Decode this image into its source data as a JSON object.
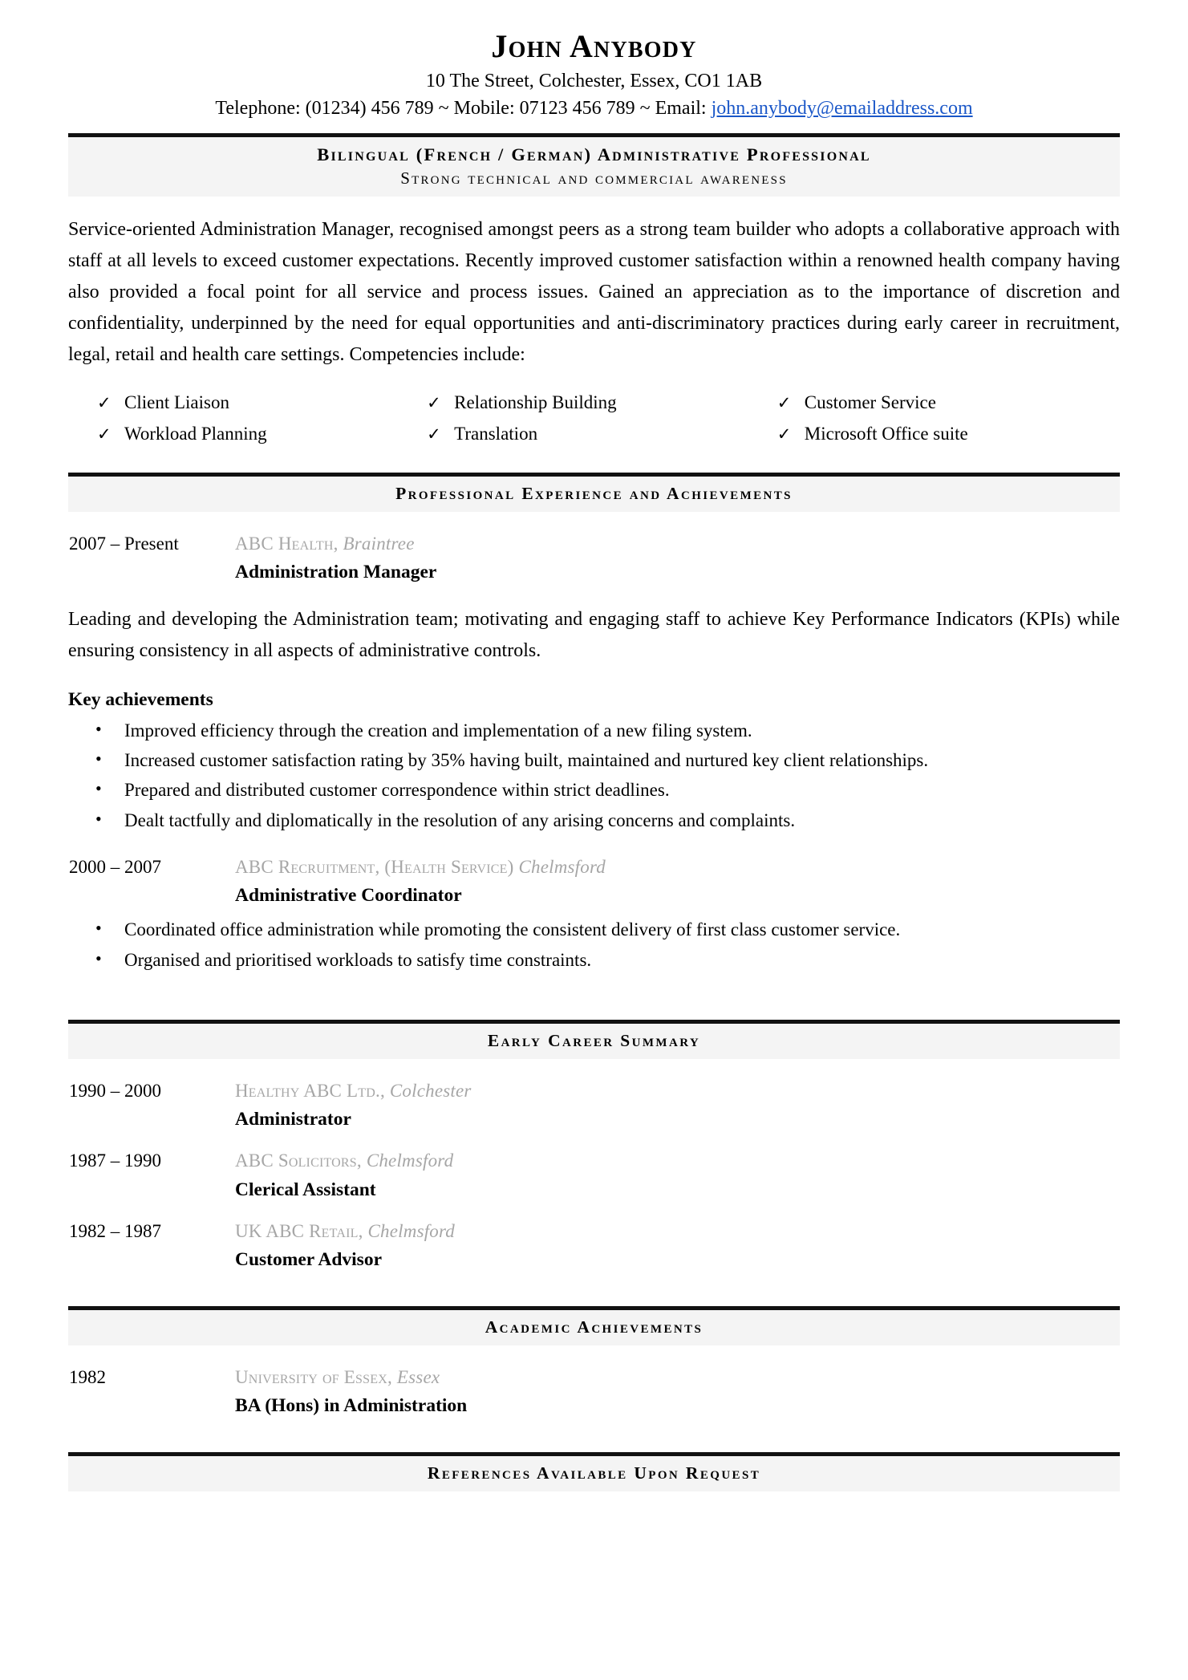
{
  "header": {
    "name": "John Anybody",
    "address": "10 The Street, Colchester, Essex, CO1 1AB",
    "contact_prefix": "Telephone: (01234) 456 789 ~ Mobile: 07123 456 789 ~ Email: ",
    "email": "john.anybody@emailaddress.com"
  },
  "title_banner": {
    "main": "Bilingual (French / German) Administrative Professional",
    "sub": "Strong technical and commercial awareness"
  },
  "profile": {
    "text": "Service-oriented Administration Manager, recognised amongst peers as a strong team builder who adopts a collaborative approach with staff at all levels to exceed customer expectations. Recently improved customer satisfaction within a renowned health company having also provided a focal point for all service and process issues. Gained an appreciation as to the importance of discretion and confidentiality, underpinned by the need for equal opportunities and anti-discriminatory practices during early career in recruitment, legal, retail and health care settings. Competencies include:"
  },
  "competencies": {
    "check_glyph": "✓",
    "rows": [
      [
        "Client Liaison",
        "Relationship Building",
        "Customer Service"
      ],
      [
        "Workload Planning",
        "Translation",
        "Microsoft Office suite"
      ]
    ]
  },
  "experience": {
    "banner": "Professional Experience and Achievements",
    "jobs": [
      {
        "dates": "2007 – Present",
        "company": "ABC Health,",
        "location": "Braintree",
        "title": "Administration Manager",
        "summary": "Leading and developing the Administration team; motivating and engaging staff to achieve Key Performance Indicators (KPIs) while ensuring consistency in all aspects of administrative controls.",
        "achievements_heading": "Key achievements",
        "bullets": [
          "Improved efficiency through the creation and implementation of a new filing system.",
          "Increased customer satisfaction rating by 35% having built, maintained and nurtured key client relationships.",
          "Prepared and distributed customer correspondence within strict deadlines.",
          "Dealt tactfully and diplomatically in the resolution of any arising concerns and complaints."
        ]
      },
      {
        "dates": "2000 – 2007",
        "company": "ABC Recruitment, (Health Service)",
        "location": "Chelmsford",
        "title": "Administrative Coordinator",
        "bullets": [
          "Coordinated office administration while promoting the consistent delivery of first class customer service.",
          "Organised and prioritised workloads to satisfy time constraints."
        ]
      }
    ]
  },
  "early_career": {
    "banner": "Early Career Summary",
    "jobs": [
      {
        "dates": "1990 – 2000",
        "company": "Healthy ABC Ltd.,",
        "location": "Colchester",
        "title": "Administrator"
      },
      {
        "dates": "1987 – 1990",
        "company": "ABC Solicitors,",
        "location": "Chelmsford",
        "title": "Clerical Assistant"
      },
      {
        "dates": "1982 – 1987",
        "company": "UK ABC Retail,",
        "location": "Chelmsford",
        "title": "Customer Advisor"
      }
    ]
  },
  "academic": {
    "banner": "Academic Achievements",
    "entries": [
      {
        "dates": "1982",
        "company": "University of Essex,",
        "location": "Essex",
        "title": "BA (Hons) in Administration"
      }
    ]
  },
  "footer": {
    "banner": "References Available Upon Request"
  }
}
